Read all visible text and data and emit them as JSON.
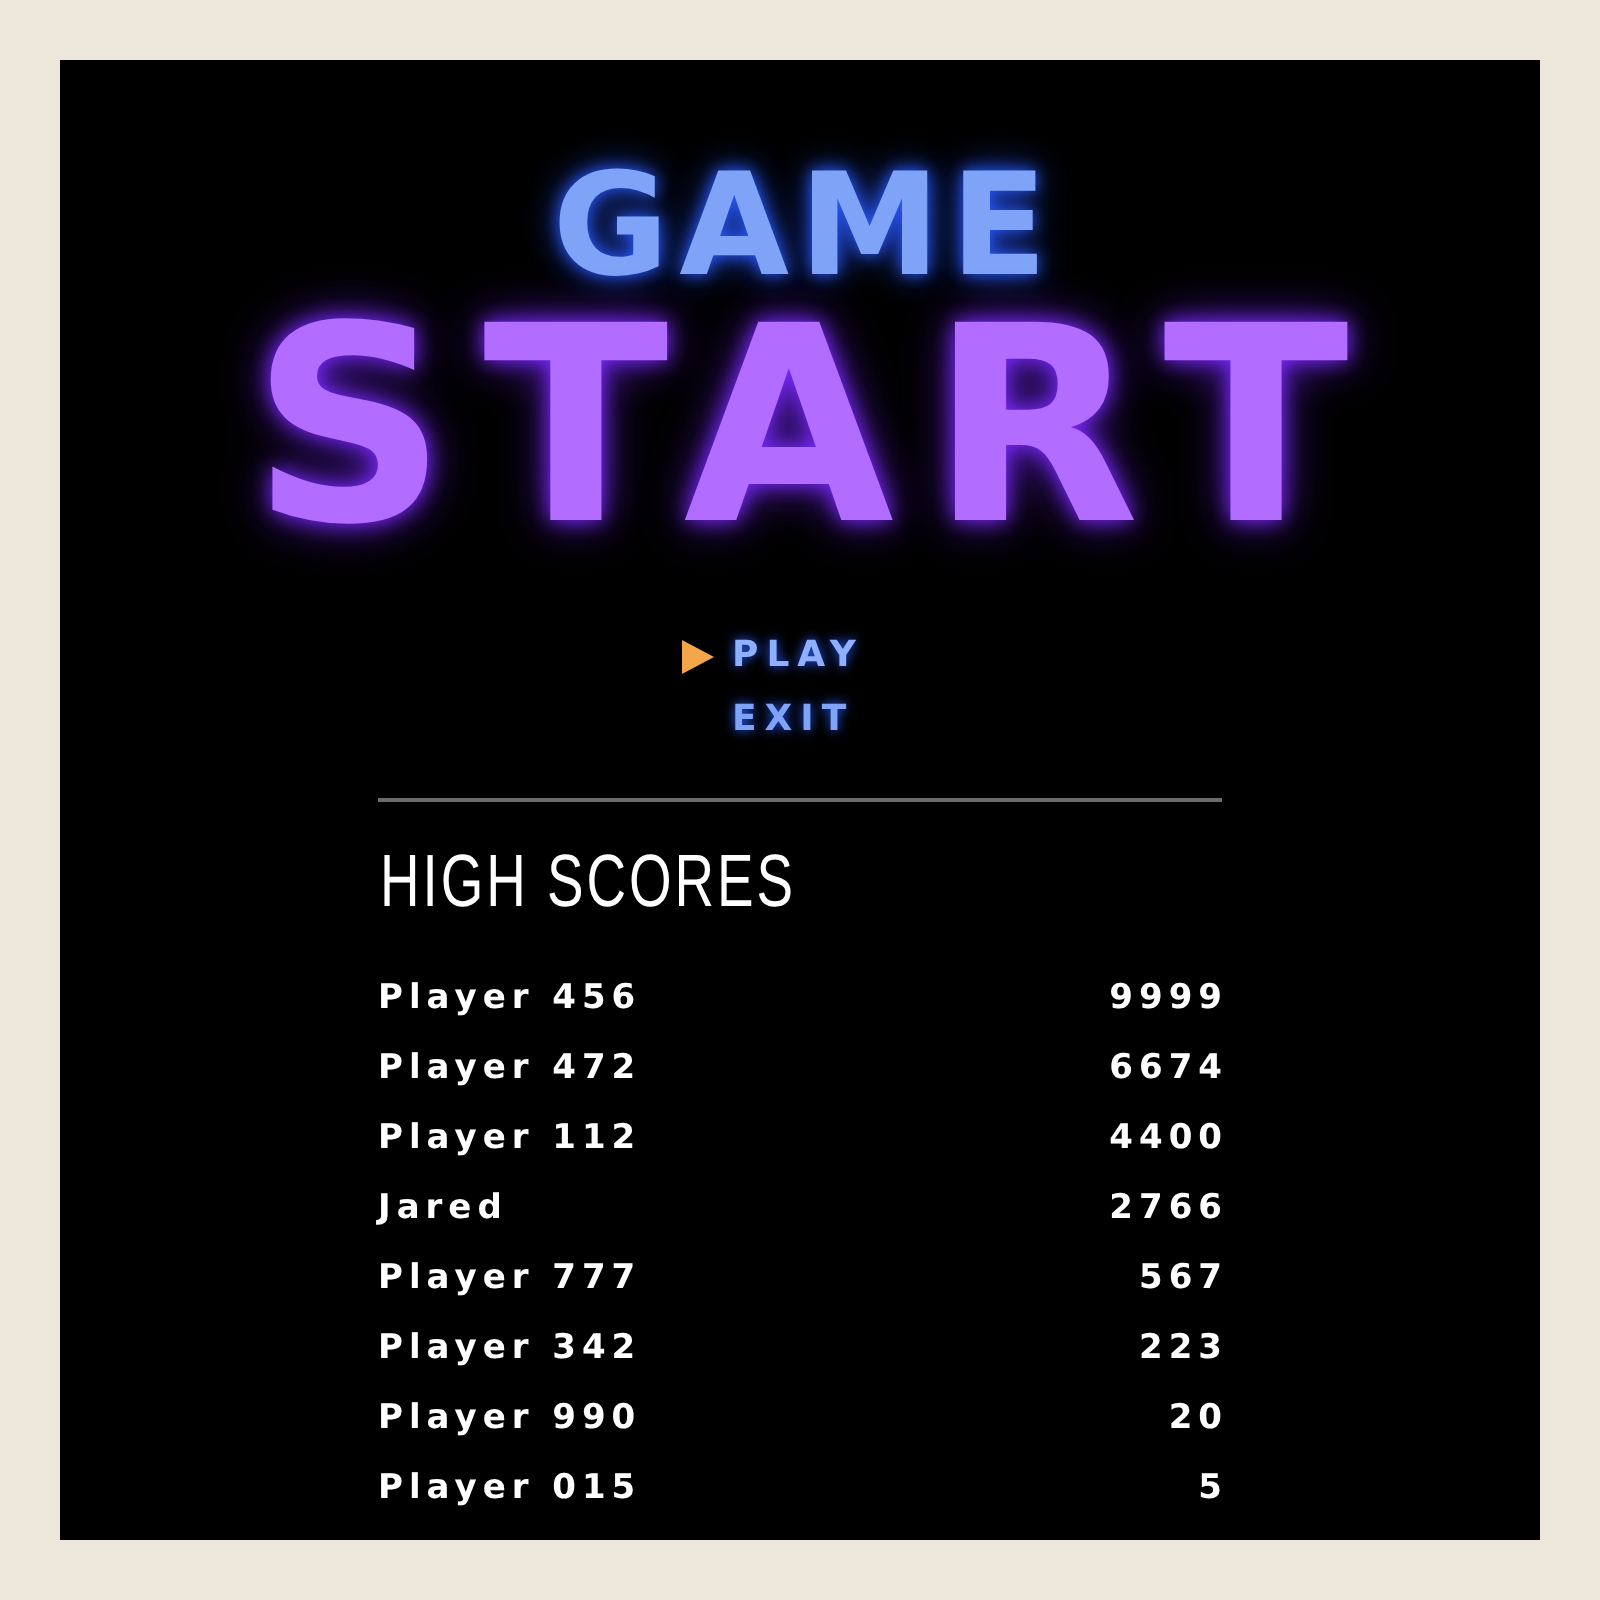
{
  "title": {
    "line_1": "GAME",
    "line_2": "START"
  },
  "menu": [
    {
      "label": "PLAY",
      "selected": true
    },
    {
      "label": "EXIT",
      "selected": false
    }
  ],
  "high_scores": {
    "heading": "HIGH SCORES",
    "rows": [
      {
        "name": "Player 456",
        "score": "9999"
      },
      {
        "name": "Player 472",
        "score": "6674"
      },
      {
        "name": "Player 112",
        "score": "4400"
      },
      {
        "name": "Jared",
        "score": "2766"
      },
      {
        "name": "Player 777",
        "score": "567"
      },
      {
        "name": "Player 342",
        "score": "223"
      },
      {
        "name": "Player 990",
        "score": "20"
      },
      {
        "name": "Player 015",
        "score": "5"
      }
    ]
  }
}
